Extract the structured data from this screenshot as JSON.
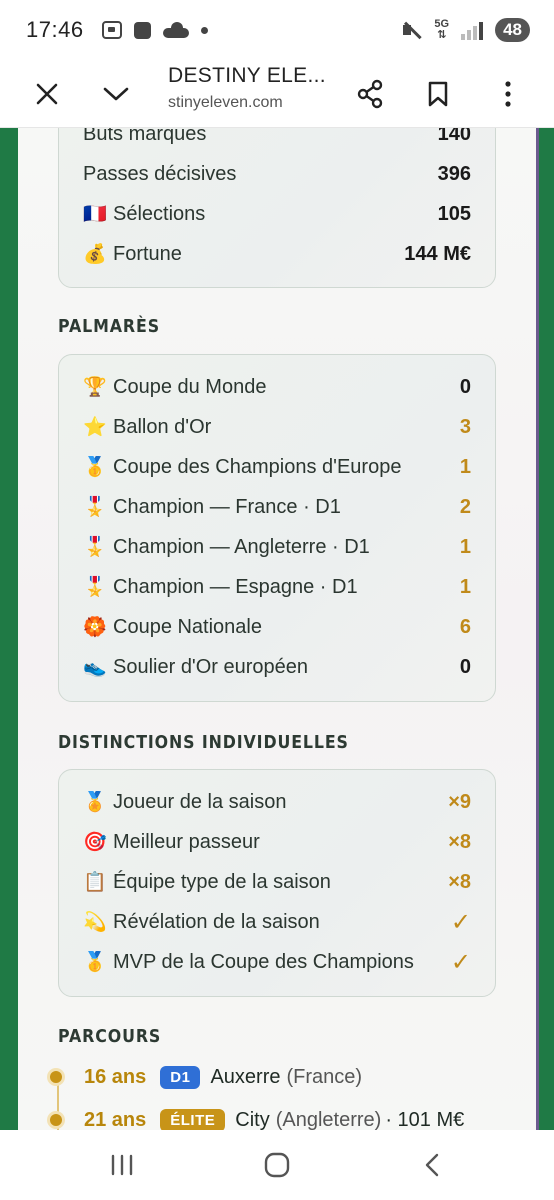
{
  "status": {
    "time": "17:46",
    "network": "5G",
    "battery": "48"
  },
  "browser": {
    "title": "DESTINY ELE...",
    "host": "stinyeleven.com"
  },
  "stats": [
    {
      "emoji": "",
      "label": "Buts marqués",
      "value": "140",
      "gold": false
    },
    {
      "emoji": "",
      "label": "Passes décisives",
      "value": "396",
      "gold": false
    },
    {
      "emoji": "🇫🇷",
      "label": "Sélections",
      "value": "105",
      "gold": false
    },
    {
      "emoji": "💰",
      "label": "Fortune",
      "value": "144 M€",
      "gold": false
    }
  ],
  "palmares": {
    "title": "PALMARÈS",
    "items": [
      {
        "emoji": "🏆",
        "label": "Coupe du Monde",
        "value": "0",
        "gold": false
      },
      {
        "emoji": "⭐",
        "label": "Ballon d'Or",
        "value": "3",
        "gold": true
      },
      {
        "emoji": "🥇",
        "label": "Coupe des Champions d'Europe",
        "value": "1",
        "gold": true
      },
      {
        "emoji": "🎖️",
        "label": "Champion — France · D1",
        "value": "2",
        "gold": true
      },
      {
        "emoji": "🎖️",
        "label": "Champion — Angleterre · D1",
        "value": "1",
        "gold": true
      },
      {
        "emoji": "🎖️",
        "label": "Champion — Espagne · D1",
        "value": "1",
        "gold": true
      },
      {
        "emoji": "🏵️",
        "label": "Coupe Nationale",
        "value": "6",
        "gold": true
      },
      {
        "emoji": "👟",
        "label": "Soulier d'Or européen",
        "value": "0",
        "gold": false
      }
    ]
  },
  "distinctions": {
    "title": "DISTINCTIONS INDIVIDUELLES",
    "items": [
      {
        "emoji": "🏅",
        "label": "Joueur de la saison",
        "value": "×9"
      },
      {
        "emoji": "🎯",
        "label": "Meilleur passeur",
        "value": "×8"
      },
      {
        "emoji": "📋",
        "label": "Équipe type de la saison",
        "value": "×8"
      },
      {
        "emoji": "💫",
        "label": "Révélation de la saison",
        "value": "✓"
      },
      {
        "emoji": "🥇",
        "label": "MVP de la Coupe des Champions",
        "value": "✓"
      }
    ]
  },
  "parcours": {
    "title": "PARCOURS",
    "entries": [
      {
        "age": "16 ans",
        "badge": "D1",
        "badge_color": "blue",
        "club": "Auxerre",
        "country": "(France)",
        "fee": ""
      },
      {
        "age": "21 ans",
        "badge": "ÉLITE",
        "badge_color": "gold",
        "club": "City",
        "country": "(Angleterre)",
        "fee": "· 101 M€"
      }
    ]
  }
}
